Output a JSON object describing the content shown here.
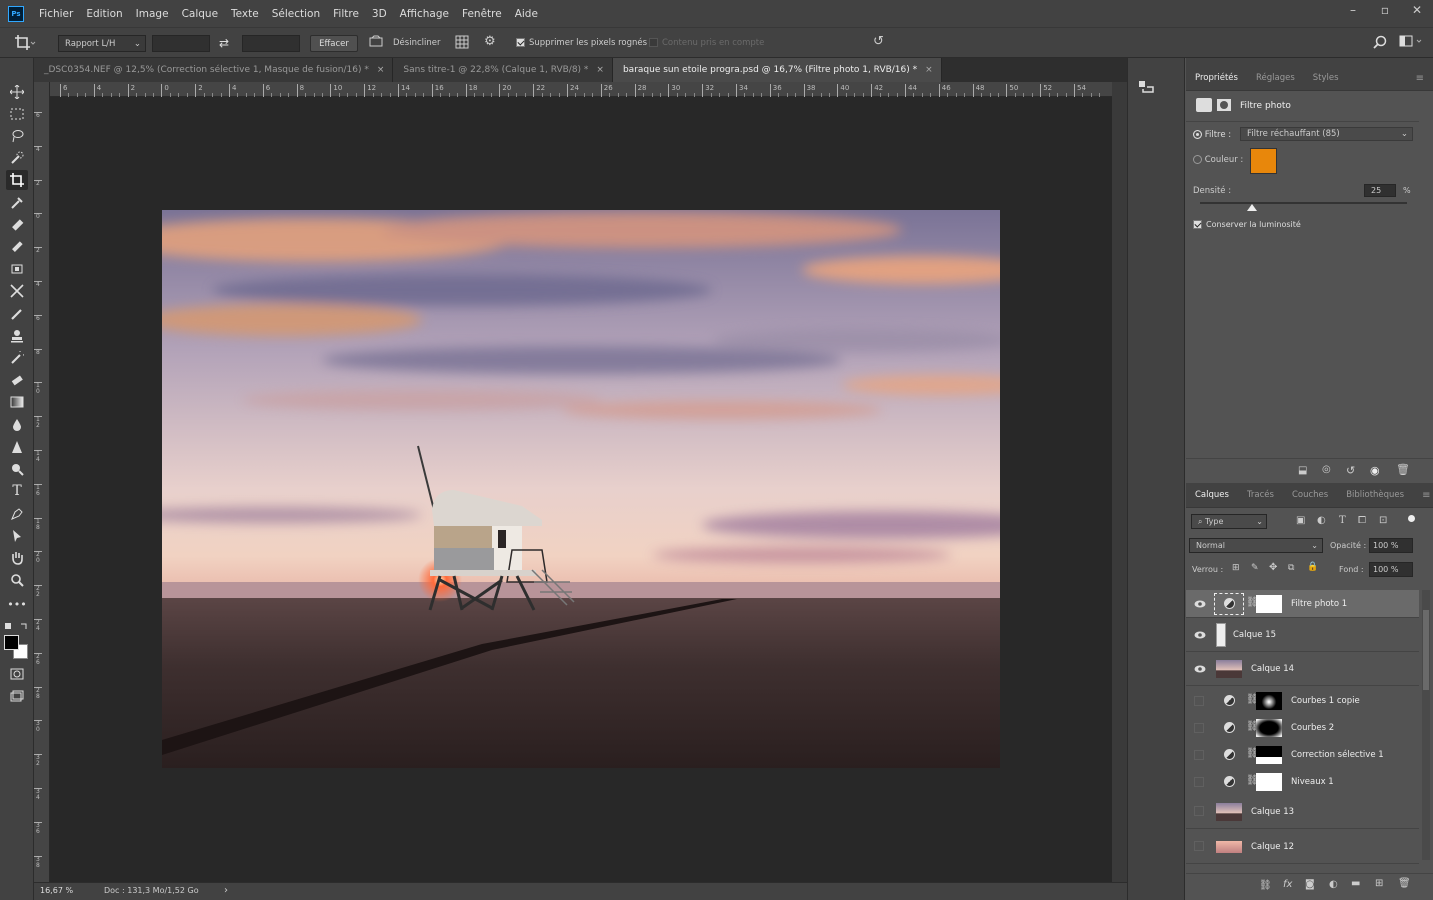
{
  "menu": {
    "app_logo": "Ps",
    "items": [
      "Fichier",
      "Edition",
      "Image",
      "Calque",
      "Texte",
      "Sélection",
      "Filtre",
      "3D",
      "Affichage",
      "Fenêtre",
      "Aide"
    ]
  },
  "options": {
    "ratio_select": "Rapport L/H",
    "clear_button": "Effacer",
    "straighten_label": "Désincliner",
    "delete_cropped_label": "Supprimer les pixels rognés",
    "content_aware_label": "Contenu pris en compte"
  },
  "tabs": [
    {
      "label": "_DSC0354.NEF @ 12,5% (Correction sélective 1, Masque de fusion/16) *",
      "close": "×"
    },
    {
      "label": "Sans titre-1 @ 22,8% (Calque 1, RVB/8) *",
      "close": "×"
    },
    {
      "label": "baraque sun etoile progra.psd @ 16,7% (Filtre photo 1, RVB/16) *",
      "close": "×"
    }
  ],
  "ruler": {
    "h_ticks": [
      "6",
      "4",
      "2",
      "0",
      "2",
      "4",
      "6",
      "8",
      "10",
      "12",
      "14",
      "16",
      "18",
      "20",
      "22",
      "24",
      "26",
      "28",
      "30",
      "32",
      "34",
      "36",
      "38",
      "40",
      "42",
      "44",
      "46",
      "48",
      "50",
      "52",
      "54"
    ],
    "v_ticks": [
      "6",
      "4",
      "2",
      "0",
      "2",
      "4",
      "6",
      "8",
      "10",
      "12",
      "14",
      "16",
      "18",
      "20",
      "22",
      "24",
      "26",
      "28",
      "30",
      "32",
      "34",
      "36",
      "38"
    ]
  },
  "status": {
    "zoom": "16,67 %",
    "doc": "Doc : 131,3 Mo/1,52 Go",
    "arrow": "›"
  },
  "properties": {
    "tabs": [
      "Propriétés",
      "Réglages",
      "Styles"
    ],
    "panel_title": "Filtre photo",
    "filter_label": "Filtre :",
    "filter_value": "Filtre réchauffant (85)",
    "color_label": "Couleur :",
    "color_swatch": "#e8870b",
    "density_label": "Densité :",
    "density_value": "25",
    "density_unit": "%",
    "density_fraction": 0.25,
    "preserve_label": "Conserver la luminosité"
  },
  "layers_panel": {
    "tabs": [
      "Calques",
      "Tracés",
      "Couches",
      "Bibliothèques"
    ],
    "filter_type": "Type",
    "blend_mode": "Normal",
    "opacity_label": "Opacité :",
    "opacity_value": "100 %",
    "lock_label": "Verrou :",
    "fill_label": "Fond :",
    "fill_value": "100 %",
    "layers": [
      {
        "name": "Filtre photo 1",
        "visible": true,
        "selected": true,
        "kind": "adjust"
      },
      {
        "name": "Calque 15",
        "visible": true,
        "selected": false,
        "kind": "pixel-mask"
      },
      {
        "name": "Calque 14",
        "visible": true,
        "selected": false,
        "kind": "pixel-photo"
      },
      {
        "name": "Courbes 1 copie",
        "visible": false,
        "selected": false,
        "kind": "adjust-blob"
      },
      {
        "name": "Courbes 2",
        "visible": false,
        "selected": false,
        "kind": "adjust-vignette"
      },
      {
        "name": "Correction sélective 1",
        "visible": false,
        "selected": false,
        "kind": "adjust-horizon"
      },
      {
        "name": "Niveaux 1",
        "visible": false,
        "selected": false,
        "kind": "adjust-white"
      },
      {
        "name": "Calque 13",
        "visible": false,
        "selected": false,
        "kind": "pixel-photo"
      },
      {
        "name": "Calque 12",
        "visible": false,
        "selected": false,
        "kind": "pixel-pink"
      }
    ]
  },
  "colors": {
    "accent": "#e8870b",
    "panel_bg": "#535353",
    "chrome_bg": "#424242",
    "canvas_bg": "#282828"
  }
}
